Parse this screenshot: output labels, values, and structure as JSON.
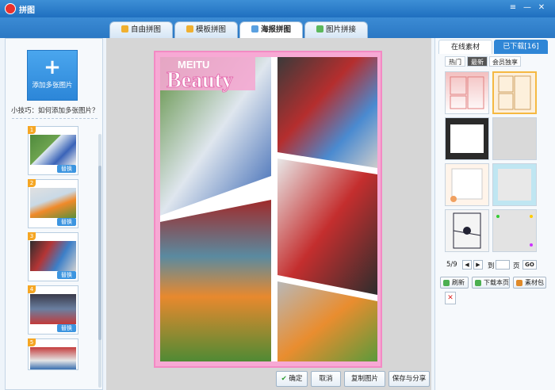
{
  "app": {
    "title": "拼图"
  },
  "tabs": [
    {
      "label": "自由拼图",
      "active": false
    },
    {
      "label": "模板拼图",
      "active": false
    },
    {
      "label": "海报拼图",
      "active": true
    },
    {
      "label": "图片拼接",
      "active": false
    }
  ],
  "left": {
    "add_label": "添加多张图片",
    "tip": "小技巧：如何添加多张图片？",
    "thumbs": [
      {
        "num": "1",
        "replace": "替换"
      },
      {
        "num": "2",
        "replace": "替换"
      },
      {
        "num": "3",
        "replace": "替换"
      },
      {
        "num": "4",
        "replace": "替换"
      },
      {
        "num": "5",
        "replace": ""
      }
    ]
  },
  "poster": {
    "brand": "MEITU",
    "title": "Beauty"
  },
  "bottom": {
    "confirm": "确定",
    "cancel": "取消",
    "copy": "复制图片",
    "save": "保存与分享"
  },
  "right": {
    "tab_online": "在线素材",
    "tab_downloaded": "已下载[16]",
    "subtabs": [
      "热门",
      "最新",
      "会员独享"
    ],
    "page_current": "5/9",
    "goto_label": "到",
    "page_unit": "页",
    "go_label": "GO",
    "refresh": "刷新",
    "download_page": "下载本页",
    "material_pack": "素材包",
    "delete_icon": "✕"
  },
  "colors": {
    "accent": "#2b78c4",
    "poster_border": "#f38ac4",
    "badge": "#f5a623"
  }
}
